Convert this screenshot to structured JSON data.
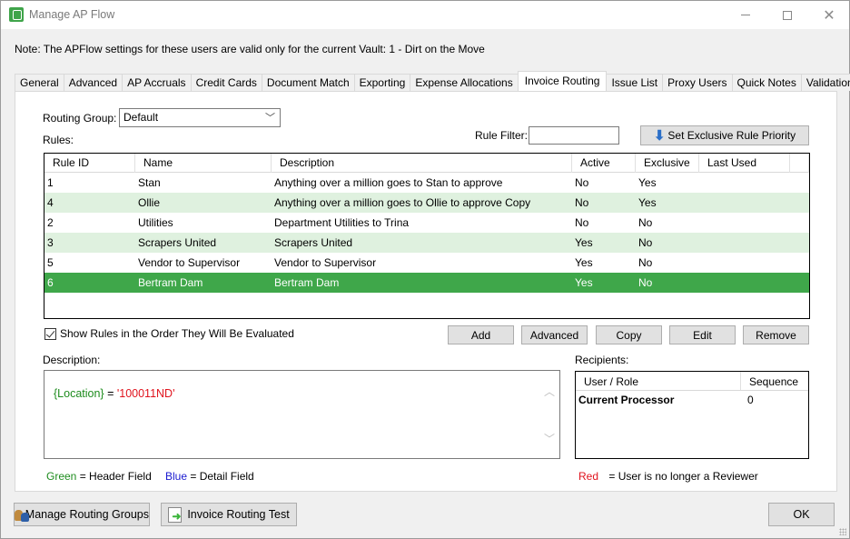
{
  "window": {
    "title": "Manage AP Flow",
    "minimize_icon": "minimize-icon",
    "maximize_icon": "maximize-icon",
    "close_icon": "close-icon",
    "close_glyph": "✕"
  },
  "note": "Note:  The APFlow settings for these users are valid only for the current Vault: 1 - Dirt on the Move",
  "tabs": [
    {
      "label": "General",
      "active": false
    },
    {
      "label": "Advanced",
      "active": false
    },
    {
      "label": "AP Accruals",
      "active": false
    },
    {
      "label": "Credit Cards",
      "active": false
    },
    {
      "label": "Document Match",
      "active": false
    },
    {
      "label": "Exporting",
      "active": false
    },
    {
      "label": "Expense Allocations",
      "active": false
    },
    {
      "label": "Invoice Routing",
      "active": true
    },
    {
      "label": "Issue List",
      "active": false
    },
    {
      "label": "Proxy Users",
      "active": false
    },
    {
      "label": "Quick Notes",
      "active": false
    },
    {
      "label": "Validation",
      "active": false
    }
  ],
  "routing": {
    "group_label": "Routing Group:",
    "group_value": "Default",
    "chevron": "﹀",
    "rules_label": "Rules:",
    "filter_label": "Rule Filter:",
    "filter_value": "",
    "priority_button": "Set Exclusive Rule Priority",
    "priority_icon_glyph": "⬇"
  },
  "rules_table": {
    "columns": [
      "Rule ID",
      "Name",
      "Description",
      "Active",
      "Exclusive",
      "Last Used"
    ],
    "rows": [
      {
        "id": "1",
        "name": "Stan",
        "description": "Anything over a million goes to Stan to approve",
        "active": "No",
        "exclusive": "Yes",
        "last_used": ""
      },
      {
        "id": "4",
        "name": "Ollie",
        "description": "Anything over a million goes to Ollie to approve Copy",
        "active": "No",
        "exclusive": "Yes",
        "last_used": ""
      },
      {
        "id": "2",
        "name": "Utilities",
        "description": "Department Utilities to Trina",
        "active": "No",
        "exclusive": "No",
        "last_used": ""
      },
      {
        "id": "3",
        "name": "Scrapers United",
        "description": "Scrapers United",
        "active": "Yes",
        "exclusive": "No",
        "last_used": ""
      },
      {
        "id": "5",
        "name": "Vendor to Supervisor",
        "description": "Vendor to Supervisor",
        "active": "Yes",
        "exclusive": "No",
        "last_used": ""
      },
      {
        "id": "6",
        "name": "Bertram Dam",
        "description": "Bertram Dam",
        "active": "Yes",
        "exclusive": "No",
        "last_used": ""
      }
    ],
    "selected_index": 5
  },
  "show_order_checkbox": {
    "label": "Show Rules in the Order They Will Be Evaluated",
    "checked": true
  },
  "actions": {
    "add": "Add",
    "advanced": "Advanced",
    "copy": "Copy",
    "edit": "Edit",
    "remove": "Remove"
  },
  "description": {
    "label": "Description:",
    "field": "{Location}",
    "operator": " = ",
    "value": "'100011ND'",
    "scroll_up": "︿",
    "scroll_down": "﹀"
  },
  "recipients": {
    "label": "Recipients:",
    "columns": [
      "User / Role",
      "Sequence"
    ],
    "rows": [
      {
        "user": "Current Processor",
        "sequence": "0"
      }
    ]
  },
  "legend": {
    "green_word": "Green",
    "green_text": " =  Header Field",
    "blue_word": "Blue",
    "blue_text": " =  Detail Field",
    "red_word": "Red",
    "red_text": " =  User is no longer a Reviewer"
  },
  "colors": {
    "green": "#1e8c1e",
    "blue": "#1a1ad0",
    "red": "#e0141e",
    "selected_row": "#3fa74a",
    "alt_row": "#dff1df"
  },
  "footer": {
    "manage_groups": "Manage Routing Groups",
    "routing_test": "Invoice Routing Test",
    "ok": "OK"
  }
}
